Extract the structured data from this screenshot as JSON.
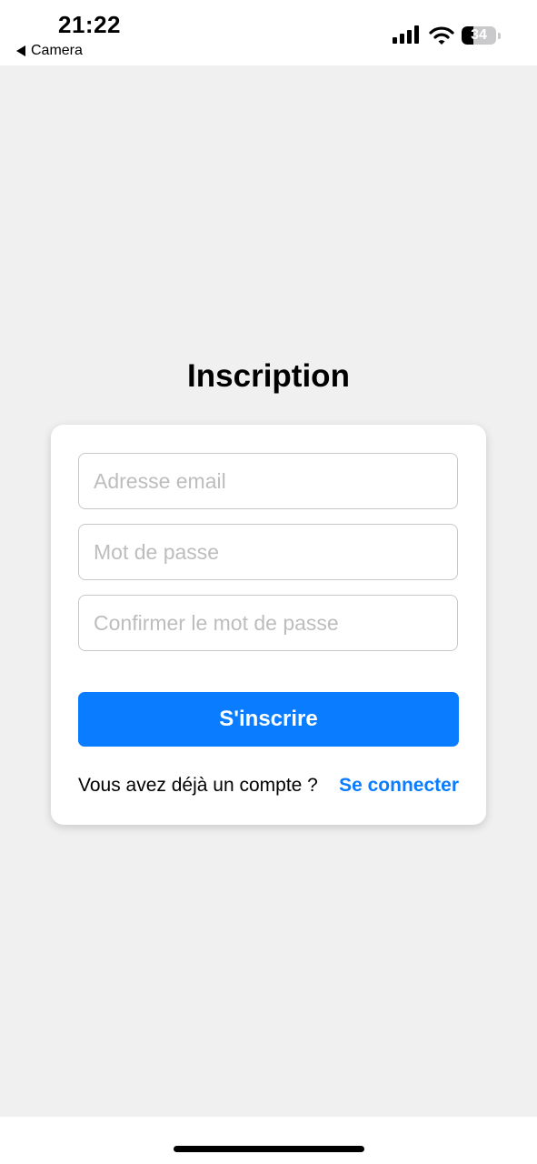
{
  "status_bar": {
    "time": "21:22",
    "back_label": "Camera",
    "battery_level": "34",
    "battery_fraction": 0.34
  },
  "page": {
    "title": "Inscription"
  },
  "form": {
    "email_placeholder": "Adresse email",
    "email_value": "",
    "password_placeholder": "Mot de passe",
    "password_value": "",
    "confirm_placeholder": "Confirmer le mot de passe",
    "confirm_value": "",
    "submit_label": "S'inscrire",
    "signin_prompt": "Vous avez déjà un compte ?",
    "signin_link": "Se connecter"
  },
  "colors": {
    "accent": "#0a7cff",
    "background": "#f0f0f0",
    "card": "#ffffff"
  },
  "icons": [
    "back-arrow-icon",
    "cellular-signal-icon",
    "wifi-icon",
    "battery-icon"
  ]
}
